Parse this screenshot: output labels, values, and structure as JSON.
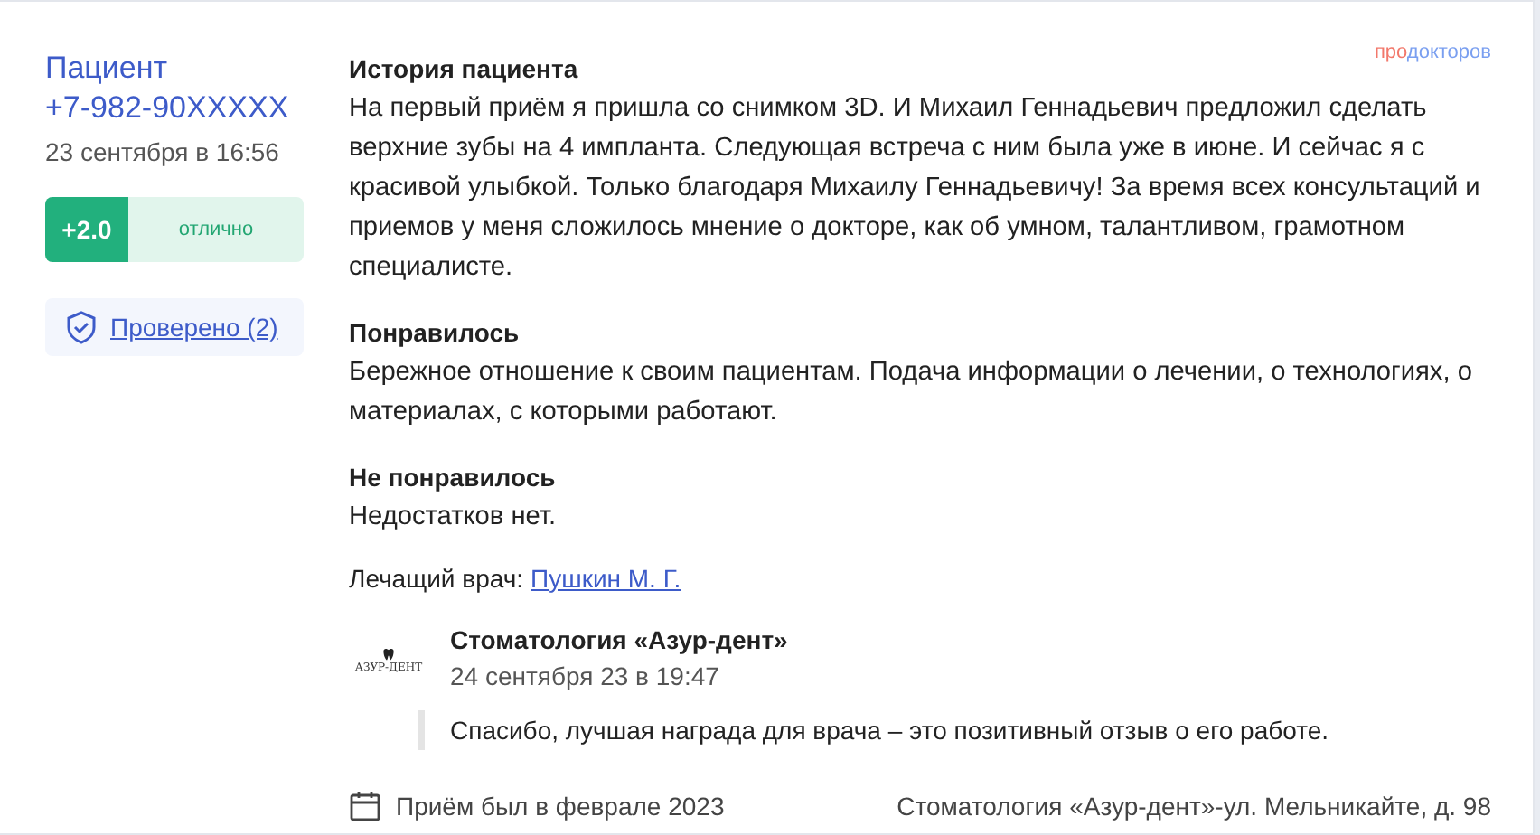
{
  "author": {
    "name": "Пациент",
    "phone": "+7-982-90XXXXX",
    "date": "23 сентября в 16:56"
  },
  "rating": {
    "score": "+2.0",
    "label": "отлично"
  },
  "verified": {
    "label": "Проверено (2)"
  },
  "brand": {
    "part_1": "про",
    "part_2": "докторов"
  },
  "sections": [
    {
      "title": "История пациента",
      "text": "На первый приём я пришла со снимком 3D. И Михаил Геннадьевич предложил сделать верхние зубы на 4 импланта. Следующая встреча с ним была уже в июне. И сейчас я с красивой улыбкой. Только благодаря Михаилу Геннадьевичу! За время всех консультаций и приемов у меня сложилось мнение о докторе, как об умном, талантливом, грамотном специалисте."
    },
    {
      "title": "Понравилось",
      "text": "Бережное отношение к своим пациентам. Подача информации о лечении, о технологиях, о материалах, с которыми работают."
    },
    {
      "title": "Не понравилось",
      "text": "Недостатков нет."
    }
  ],
  "doctor": {
    "label": "Лечащий врач:",
    "name": "Пушкин М. Г."
  },
  "reply": {
    "logo_text": "АЗУР-ДЕНТ",
    "author": "Стоматология «Азур-дент»",
    "date": "24 сентября 23 в 19:47",
    "text": "Спасибо, лучшая награда для врача – это позитивный отзыв о его работе."
  },
  "footer": {
    "visit": "Приём был в феврале 2023",
    "clinic": "Стоматология «Азур-дент»-ул. Мельникайте, д. 98"
  }
}
